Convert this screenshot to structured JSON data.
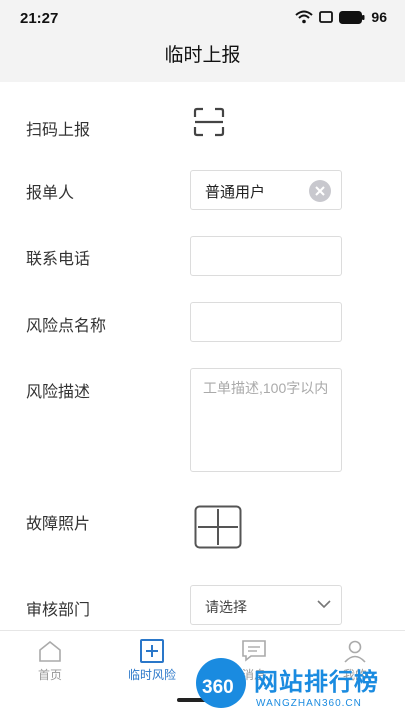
{
  "status_bar": {
    "time": "21:27",
    "battery": "96"
  },
  "header": {
    "title": "临时上报"
  },
  "form": {
    "scan_label": "扫码上报",
    "reporter_label": "报单人",
    "reporter_value": "普通用户",
    "phone_label": "联系电话",
    "phone_value": "",
    "risk_point_label": "风险点名称",
    "risk_point_value": "",
    "risk_desc_label": "风险描述",
    "risk_desc_placeholder": "工单描述,100字以内",
    "photo_label": "故障照片",
    "dept_label": "审核部门",
    "dept_value": "请选择"
  },
  "tabbar": {
    "tabs": [
      {
        "label": "首页",
        "icon": "home-icon",
        "active": false
      },
      {
        "label": "临时风险",
        "icon": "plus-square-icon",
        "active": true
      },
      {
        "label": "消息",
        "icon": "message-icon",
        "active": false
      },
      {
        "label": "我的",
        "icon": "user-icon",
        "active": false
      }
    ]
  },
  "watermark": {
    "badge": "360",
    "title": "网站排行榜",
    "subtitle": "WANGZHAN360.CN"
  },
  "colors": {
    "accent": "#2a77c9",
    "watermark": "#1a8be0",
    "header_bg": "#f3f3f3"
  }
}
